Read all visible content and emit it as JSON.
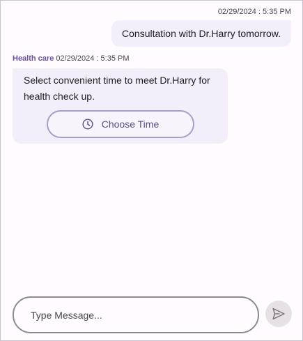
{
  "colors": {
    "background": "#FFFBFE",
    "bubble": "#F3EFFA",
    "author": "#6750A4",
    "button_border": "#A89CC8",
    "button_text": "#5B4C8A",
    "send_bg": "#E6E1E5"
  },
  "messages": {
    "outgoing": {
      "timestamp": "02/29/2024 : 5:35 PM",
      "text": "Consultation with Dr.Harry tomorrow."
    },
    "incoming": {
      "author": "Health care",
      "timestamp": "02/29/2024 : 5:35 PM",
      "text": "Select convenient time to meet Dr.Harry for health check up.",
      "action": {
        "label": "Choose Time",
        "icon": "clock-icon"
      }
    }
  },
  "composer": {
    "placeholder": "Type Message...",
    "value": "",
    "send_icon": "send-icon"
  }
}
